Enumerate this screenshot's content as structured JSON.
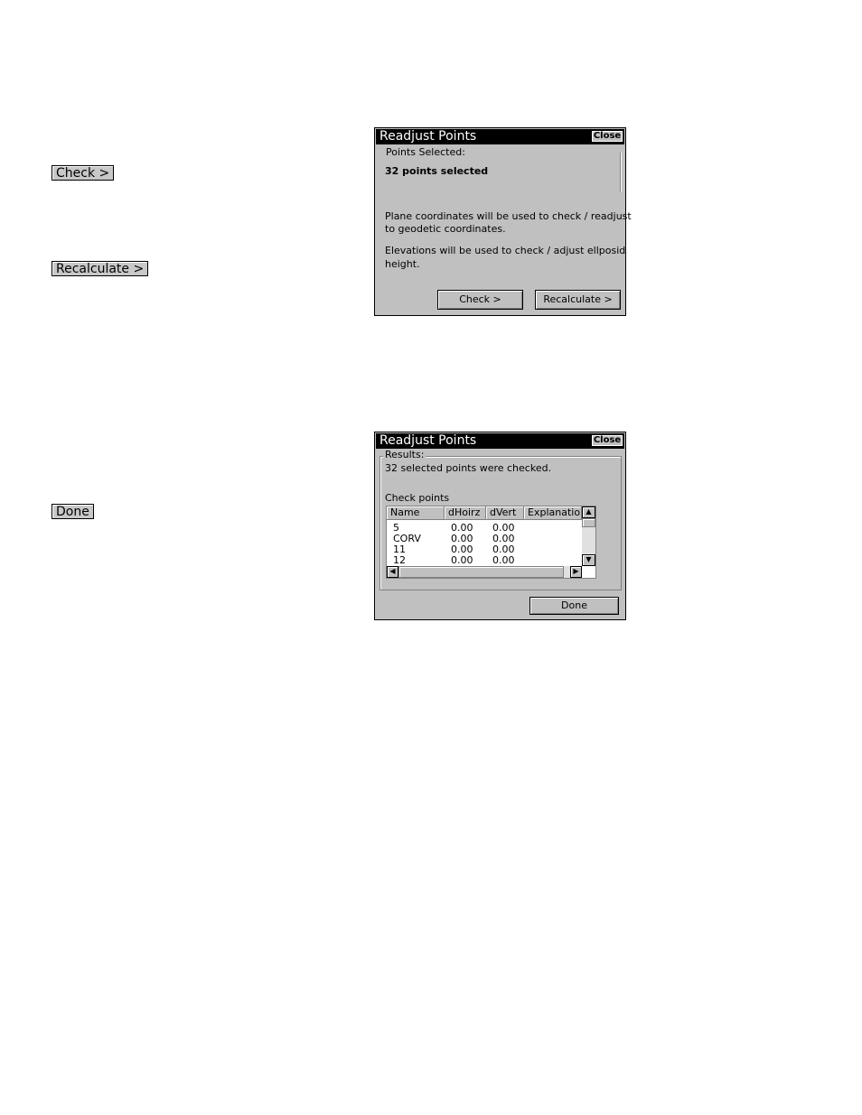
{
  "side_buttons": {
    "check": "Check >",
    "recalculate": "Recalculate >",
    "done": "Done"
  },
  "dialog1": {
    "title": "Readjust Points",
    "close_label": "Close",
    "points_selected_label": "Points Selected:",
    "points_selected_value": "32 points selected",
    "paragraph1_line1": "Plane coordinates will be used to check / readjust",
    "paragraph1_line2": "to geodetic coordinates.",
    "paragraph2_line1": "Elevations will be used to check / adjust ellposid",
    "paragraph2_line2": "height.",
    "check_button": "Check >",
    "recalculate_button": "Recalculate >"
  },
  "dialog2": {
    "title": "Readjust Points",
    "close_label": "Close",
    "results_label": "Results:",
    "results_text": "32 selected points were checked.",
    "check_points_label": "Check points",
    "columns": [
      "Name",
      "dHoirz",
      "dVert",
      "Explanation"
    ],
    "rows": [
      [
        "5",
        "0.00",
        "0.00",
        ""
      ],
      [
        "CORV",
        "0.00",
        "0.00",
        ""
      ],
      [
        "11",
        "0.00",
        "0.00",
        ""
      ],
      [
        "12",
        "0.00",
        "0.00",
        ""
      ]
    ],
    "done_button": "Done"
  },
  "icons": {
    "scroll_up": "▲",
    "scroll_down": "▼",
    "scroll_left": "◀",
    "scroll_right": "▶"
  }
}
